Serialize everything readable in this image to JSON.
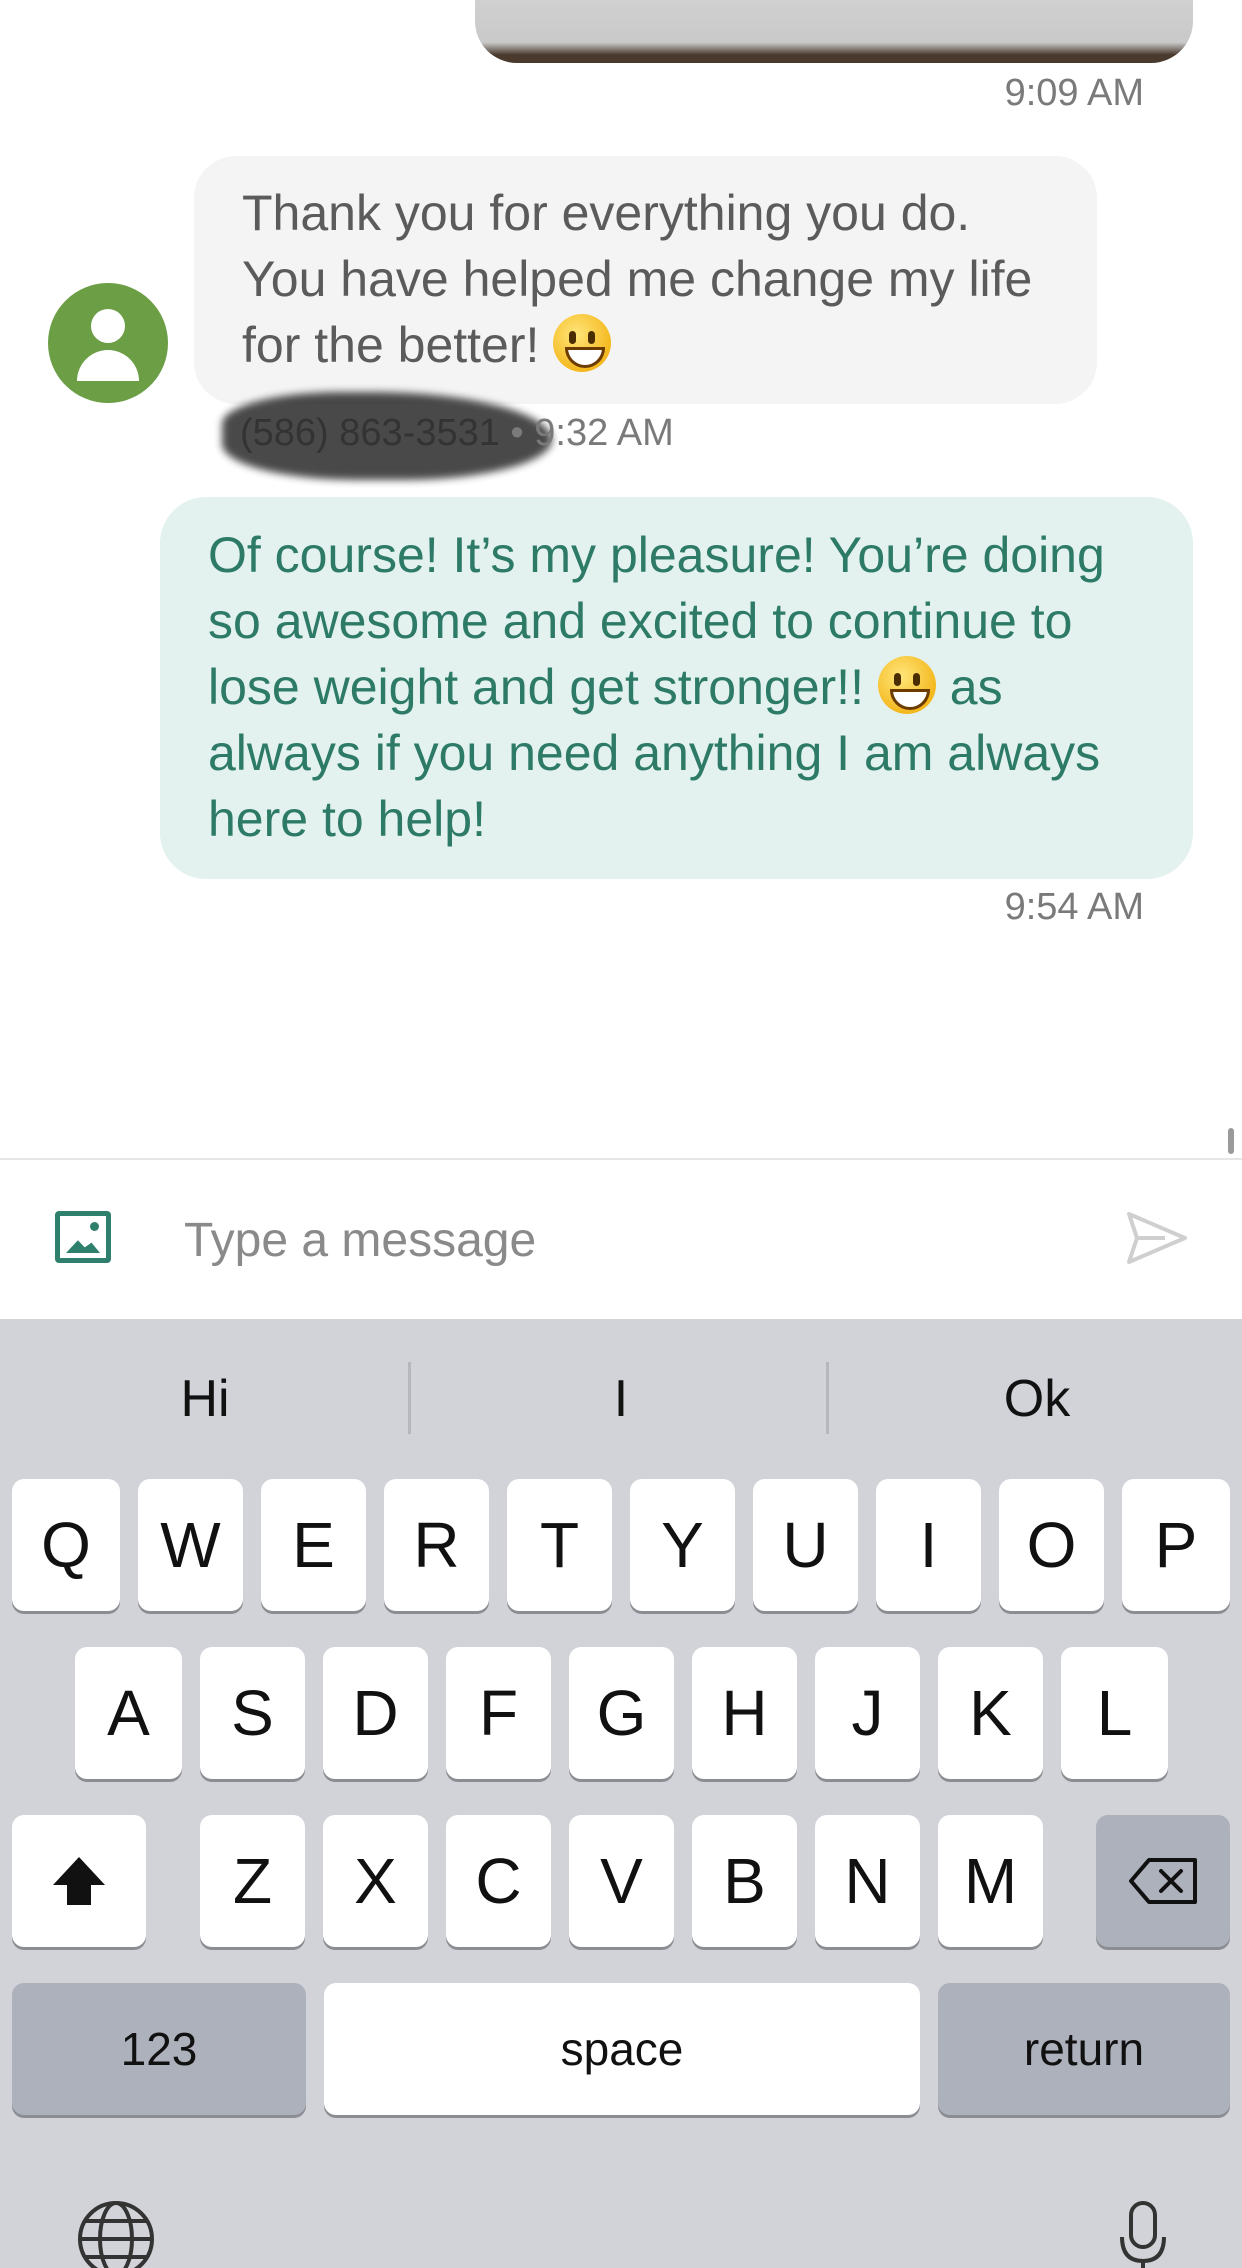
{
  "messages": [
    {
      "type": "image",
      "time": "9:09 AM"
    },
    {
      "type": "incoming",
      "text": "Thank you for everything you do. You have helped me change my life for the better!",
      "emoji": "grinning-face",
      "sender": "(586) 863-3531",
      "separator": "•",
      "time": "9:32 AM"
    },
    {
      "type": "outgoing",
      "text_part1": "Of course! It’s my pleasure! You’re doing so awesome and excited to continue to lose weight and get stronger!!",
      "emoji": "smiling-face",
      "text_part2": "as always if you need anything I am always here to help!",
      "time": "9:54 AM"
    }
  ],
  "composer": {
    "placeholder": "Type a message",
    "attach_icon": "image-icon",
    "send_icon": "send-icon"
  },
  "keyboard": {
    "suggestions": [
      "Hi",
      "I",
      "Ok"
    ],
    "row1": [
      "Q",
      "W",
      "E",
      "R",
      "T",
      "Y",
      "U",
      "I",
      "O",
      "P"
    ],
    "row2": [
      "A",
      "S",
      "D",
      "F",
      "G",
      "H",
      "J",
      "K",
      "L"
    ],
    "row3": [
      "Z",
      "X",
      "C",
      "V",
      "B",
      "N",
      "M"
    ],
    "shift_icon": "shift-icon",
    "delete_icon": "backspace-icon",
    "numbers_label": "123",
    "space_label": "space",
    "return_label": "return",
    "globe_icon": "globe-icon",
    "mic_icon": "microphone-icon"
  },
  "colors": {
    "accent": "#2f7f6d",
    "outgoing_bubble": "#e3f2ef",
    "incoming_bubble": "#f4f4f4",
    "avatar": "#6c9e45",
    "keyboard_bg": "#d1d3d9"
  }
}
